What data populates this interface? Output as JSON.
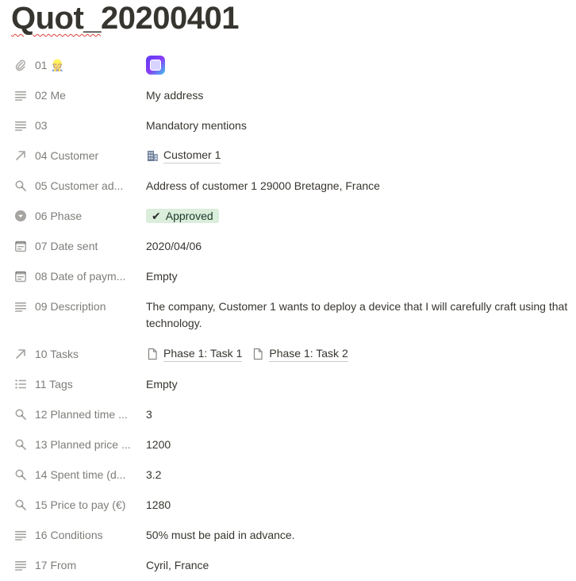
{
  "page": {
    "title_underlined": "Quot_",
    "title_rest": "20200401"
  },
  "properties": [
    {
      "label": "01",
      "icon": "paperclip-icon",
      "emoji": "👷",
      "value_type": "app-icon"
    },
    {
      "label": "02 Me",
      "icon": "text-icon",
      "value": "My address"
    },
    {
      "label": "03",
      "icon": "text-icon",
      "value": "Mandatory mentions"
    },
    {
      "label": "04 Customer",
      "icon": "relation-arrow-icon",
      "value": "Customer 1",
      "value_icon": "building-icon"
    },
    {
      "label": "05 Customer ad...",
      "icon": "rollup-search-icon",
      "value": "Address of customer 1 29000 Bretagne, France"
    },
    {
      "label": "06 Phase",
      "icon": "select-circle-icon",
      "value": "Approved",
      "value_prefix": "✔"
    },
    {
      "label": "07 Date sent",
      "icon": "calendar-icon",
      "value": "2020/04/06"
    },
    {
      "label": "08 Date of paym...",
      "icon": "calendar-icon",
      "value": "Empty"
    },
    {
      "label": "09 Description",
      "icon": "text-icon",
      "value": "The company, Customer 1 wants to deploy a device that I will carefully craft using that technology."
    },
    {
      "label": "10 Tasks",
      "icon": "relation-arrow-icon",
      "values": [
        "Phase 1: Task 1",
        "Phase 1: Task 2"
      ]
    },
    {
      "label": "11 Tags",
      "icon": "multi-select-list-icon",
      "value": "Empty"
    },
    {
      "label": "12 Planned time ...",
      "icon": "rollup-search-icon",
      "value": "3"
    },
    {
      "label": "13 Planned price ...",
      "icon": "rollup-search-icon",
      "value": "1200"
    },
    {
      "label": "14 Spent time (d...",
      "icon": "rollup-search-icon",
      "value": "3.2"
    },
    {
      "label": "15 Price to pay (€)",
      "icon": "rollup-search-icon",
      "value": "1280"
    },
    {
      "label": "16 Conditions",
      "icon": "text-icon",
      "value": "50% must be paid in advance."
    },
    {
      "label": "17 From",
      "icon": "text-icon",
      "value": "Cyril, France"
    }
  ],
  "colors": {
    "approved_chip_bg": "#dbeddb",
    "text": "#37352f",
    "muted": "rgba(55,53,47,0.38)"
  }
}
